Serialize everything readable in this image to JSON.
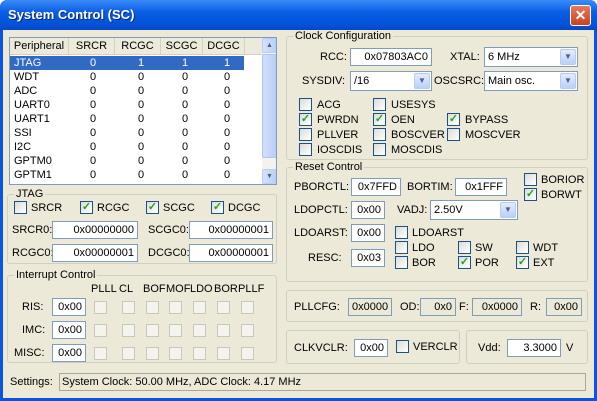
{
  "window": {
    "title": "System Control (SC)",
    "close_glyph": "✕"
  },
  "peripheral_table": {
    "headers": [
      "Peripheral",
      "SRCR",
      "RCGC",
      "SCGC",
      "DCGC"
    ],
    "rows": [
      [
        "JTAG",
        "0",
        "1",
        "1",
        "1"
      ],
      [
        "WDT",
        "0",
        "0",
        "0",
        "0"
      ],
      [
        "ADC",
        "0",
        "0",
        "0",
        "0"
      ],
      [
        "UART0",
        "0",
        "0",
        "0",
        "0"
      ],
      [
        "UART1",
        "0",
        "0",
        "0",
        "0"
      ],
      [
        "SSI",
        "0",
        "0",
        "0",
        "0"
      ],
      [
        "I2C",
        "0",
        "0",
        "0",
        "0"
      ],
      [
        "GPTM0",
        "0",
        "0",
        "0",
        "0"
      ],
      [
        "GPTM1",
        "0",
        "0",
        "0",
        "0"
      ]
    ],
    "selected_row": 0
  },
  "jtag": {
    "title": "JTAG",
    "checks": [
      {
        "label": "SRCR",
        "checked": false
      },
      {
        "label": "RCGC",
        "checked": true
      },
      {
        "label": "SCGC",
        "checked": true
      },
      {
        "label": "DCGC",
        "checked": true
      }
    ],
    "srcr0_label": "SRCR0:",
    "srcr0": "0x00000000",
    "scgc0_label": "SCGC0:",
    "scgc0": "0x00000001",
    "rcgc0_label": "RCGC0:",
    "rcgc0": "0x00000001",
    "dcgc0_label": "DCGC0:",
    "dcgc0": "0x00000001"
  },
  "interrupt": {
    "title": "Interrupt Control",
    "columns": [
      "PLLL",
      "CL",
      "BOF",
      "MOF",
      "LDO",
      "BOR",
      "PLLF"
    ],
    "rows": [
      {
        "label": "RIS:",
        "value": "0x00"
      },
      {
        "label": "IMC:",
        "value": "0x00"
      },
      {
        "label": "MISC:",
        "value": "0x00"
      }
    ]
  },
  "clock": {
    "title": "Clock Configuration",
    "rcc_label": "RCC:",
    "rcc": "0x07803AC0",
    "xtal_label": "XTAL:",
    "xtal": "6 MHz",
    "sysdiv_label": "SYSDIV:",
    "sysdiv": "/16",
    "oscsrc_label": "OSCSRC:",
    "oscsrc": "Main osc.",
    "checks": [
      {
        "label": "ACG",
        "checked": false
      },
      {
        "label": "USESYS",
        "checked": false
      },
      {
        "label": "PWRDN",
        "checked": true
      },
      {
        "label": "OEN",
        "checked": true
      },
      {
        "label": "BYPASS",
        "checked": true
      },
      {
        "label": "PLLVER",
        "checked": false
      },
      {
        "label": "BOSCVER",
        "checked": false
      },
      {
        "label": "MOSCVER",
        "checked": false
      },
      {
        "label": "IOSCDIS",
        "checked": false
      },
      {
        "label": "MOSCDIS",
        "checked": false
      }
    ]
  },
  "reset": {
    "title": "Reset Control",
    "pborctl_label": "PBORCTL:",
    "pborctl": "0x7FFD",
    "bortim_label": "BORTIM:",
    "bortim": "0x1FFF",
    "borior_label": "BORIOR",
    "borior": false,
    "borwt_label": "BORWT",
    "borwt": true,
    "ldopctl_label": "LDOPCTL:",
    "ldopctl": "0x00",
    "vadj_label": "VADJ:",
    "vadj": "2.50V",
    "ldoarst_label": "LDOARST:",
    "ldoarst": "0x00",
    "ldoarst_cb_label": "LDOARST",
    "ldoarst_cb": false,
    "resc_label": "RESC:",
    "resc": "0x03",
    "flags": [
      {
        "label": "LDO",
        "checked": false
      },
      {
        "label": "SW",
        "checked": false
      },
      {
        "label": "WDT",
        "checked": false
      },
      {
        "label": "BOR",
        "checked": false
      },
      {
        "label": "POR",
        "checked": true
      },
      {
        "label": "EXT",
        "checked": true
      }
    ]
  },
  "pll": {
    "pllcfg_label": "PLLCFG:",
    "pllcfg": "0x0000",
    "od_label": "OD:",
    "od": "0x0",
    "f_label": "F:",
    "f": "0x0000",
    "r_label": "R:",
    "r": "0x00"
  },
  "clkvclr": {
    "label": "CLKVCLR:",
    "value": "0x00",
    "cb_label": "VERCLR",
    "checked": false
  },
  "vdd": {
    "label": "Vdd:",
    "value": "3.3000",
    "unit": "V"
  },
  "settings": {
    "label": "Settings:",
    "value": "System Clock: 50.00 MHz, ADC Clock: 4.17 MHz"
  }
}
